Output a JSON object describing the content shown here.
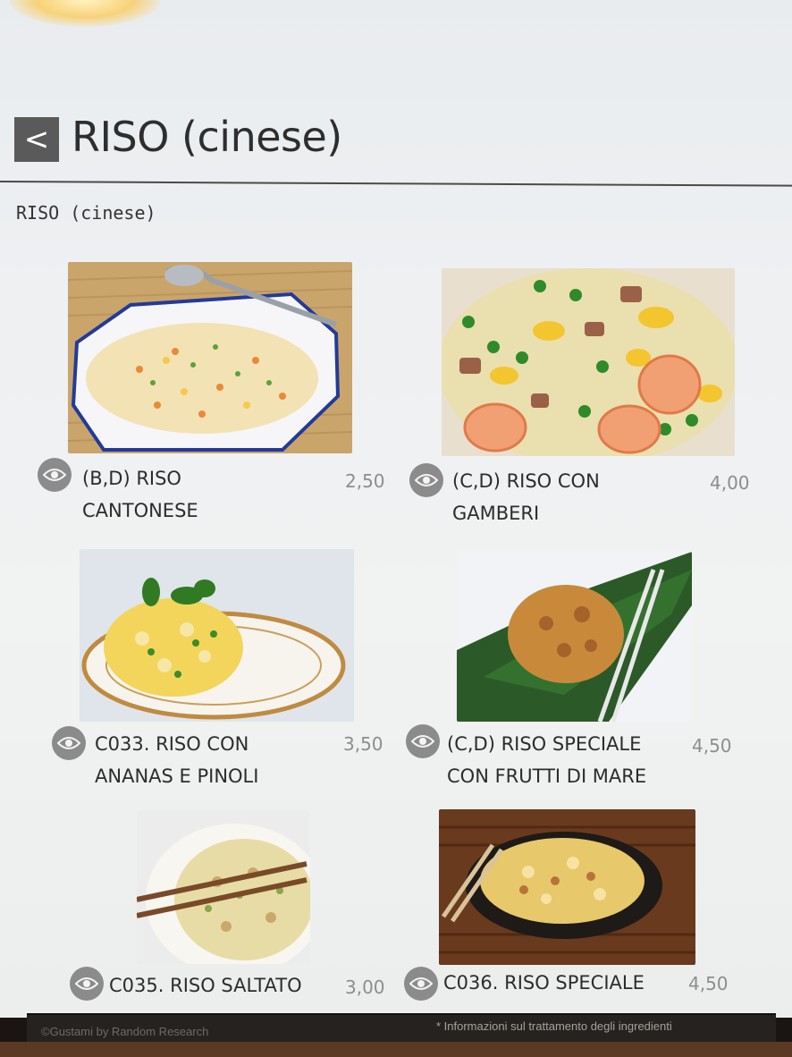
{
  "header": {
    "back_label": "<",
    "title": "RISO (cinese)"
  },
  "category_label": "RISO (cinese)",
  "dishes": [
    {
      "name_line1": "(B,D) RISO",
      "name_line2": "CANTONESE",
      "price": "2,50",
      "icon": "eye-icon"
    },
    {
      "name_line1": "(C,D) RISO CON",
      "name_line2": "GAMBERI",
      "price": "4,00",
      "icon": "eye-icon"
    },
    {
      "name_line1": "C033. RISO CON",
      "name_line2": "ANANAS E PINOLI",
      "price": "3,50",
      "icon": "eye-icon"
    },
    {
      "name_line1": "(C,D) RISO SPECIALE",
      "name_line2": "CON FRUTTI DI MARE",
      "price": "4,50",
      "icon": "eye-icon"
    },
    {
      "name_line1": "C035. RISO SALTATO",
      "name_line2": "",
      "price": "3,00",
      "icon": "eye-icon"
    },
    {
      "name_line1": "C036. RISO SPECIALE",
      "name_line2": "",
      "price": "4,50",
      "icon": "eye-icon"
    }
  ],
  "footer": {
    "credit": "©Gustami by Random Research",
    "info_link": "* Informazioni sul trattamento degli ingredienti"
  },
  "colors": {
    "back_button": "#5a5a5a",
    "title_text": "#2e2e2e",
    "price_text": "#8d8d8d",
    "eye_icon_bg": "#8b8b8b",
    "footer_bg": "#262220"
  }
}
